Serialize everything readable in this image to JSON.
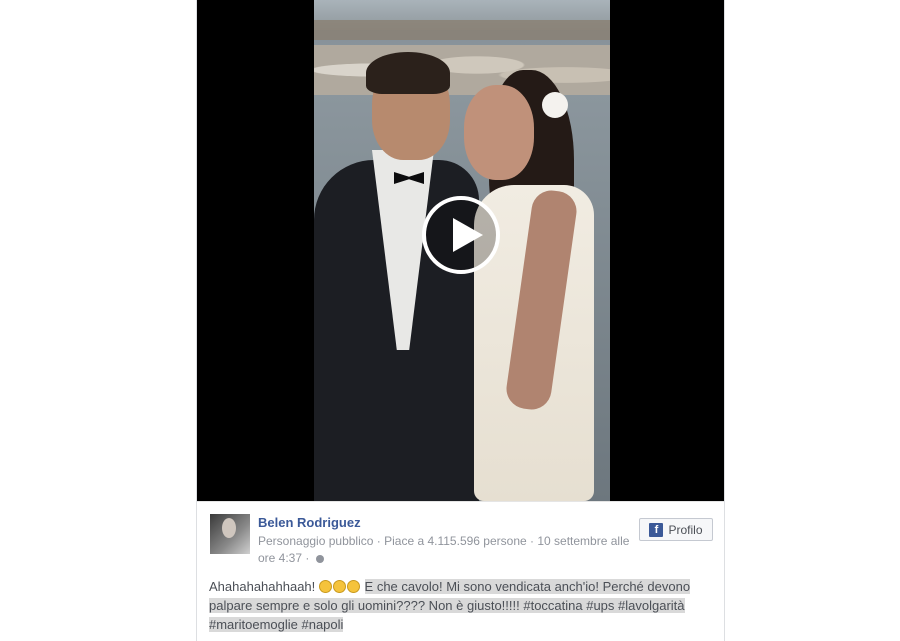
{
  "post": {
    "page_name": "Belen Rodriguez",
    "category": "Personaggio pubblico",
    "likes": "Piace a 4.115.596 persone",
    "date_line": "10 settembre alle",
    "time": "ore 4:37",
    "separator": "·",
    "profile_button": "Profilo",
    "fb_icon_glyph": "f",
    "caption_start": "Ahahahahahhaah!",
    "caption_rest": "E che cavolo! Mi sono vendicata anch'io! Perché devono palpare sempre e solo gli uomini???? Non è giusto!!!!! #toccatina #ups #lavolgarità #maritoemoglie #napoli",
    "emoji_count": 3
  },
  "video": {
    "play_icon": "play-icon"
  },
  "colors": {
    "link_blue": "#3b5998",
    "meta_gray": "#90949c",
    "highlight": "#d9d9d9"
  }
}
